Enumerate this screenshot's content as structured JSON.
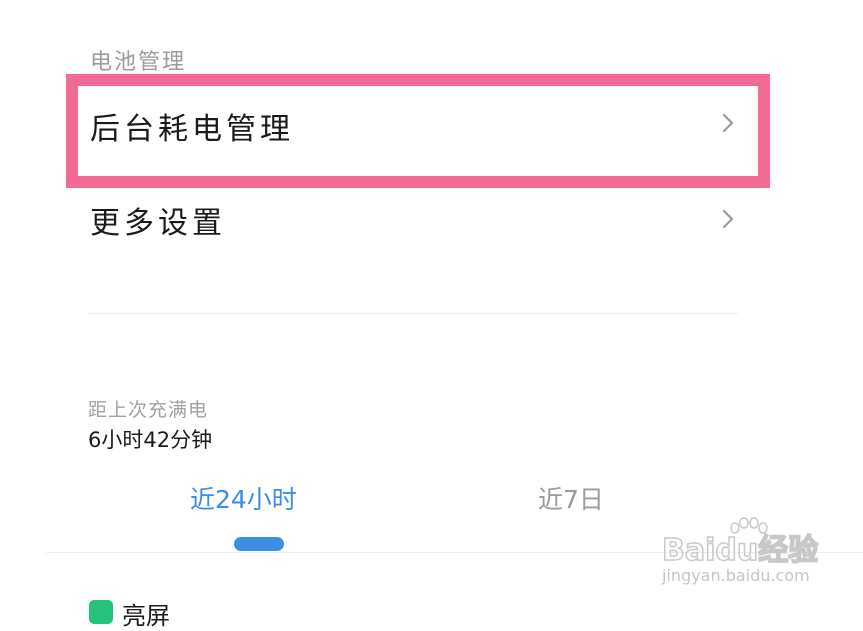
{
  "battery": {
    "section_title": "电池管理",
    "items": [
      {
        "label": "后台耗电管理",
        "icon": "chevron-right-icon"
      },
      {
        "label": "更多设置",
        "icon": "chevron-right-icon"
      }
    ]
  },
  "charge_info": {
    "label": "距上次充满电",
    "value": "6小时42分钟"
  },
  "tabs": [
    {
      "label": "近24小时",
      "active": true
    },
    {
      "label": "近7日",
      "active": false
    }
  ],
  "legend": {
    "label": "亮屏",
    "color": "#26c17b"
  },
  "highlight": {
    "color": "#f26b94"
  },
  "watermark": {
    "brand": "Baidu经验",
    "url": "jingyan.baidu.com"
  }
}
